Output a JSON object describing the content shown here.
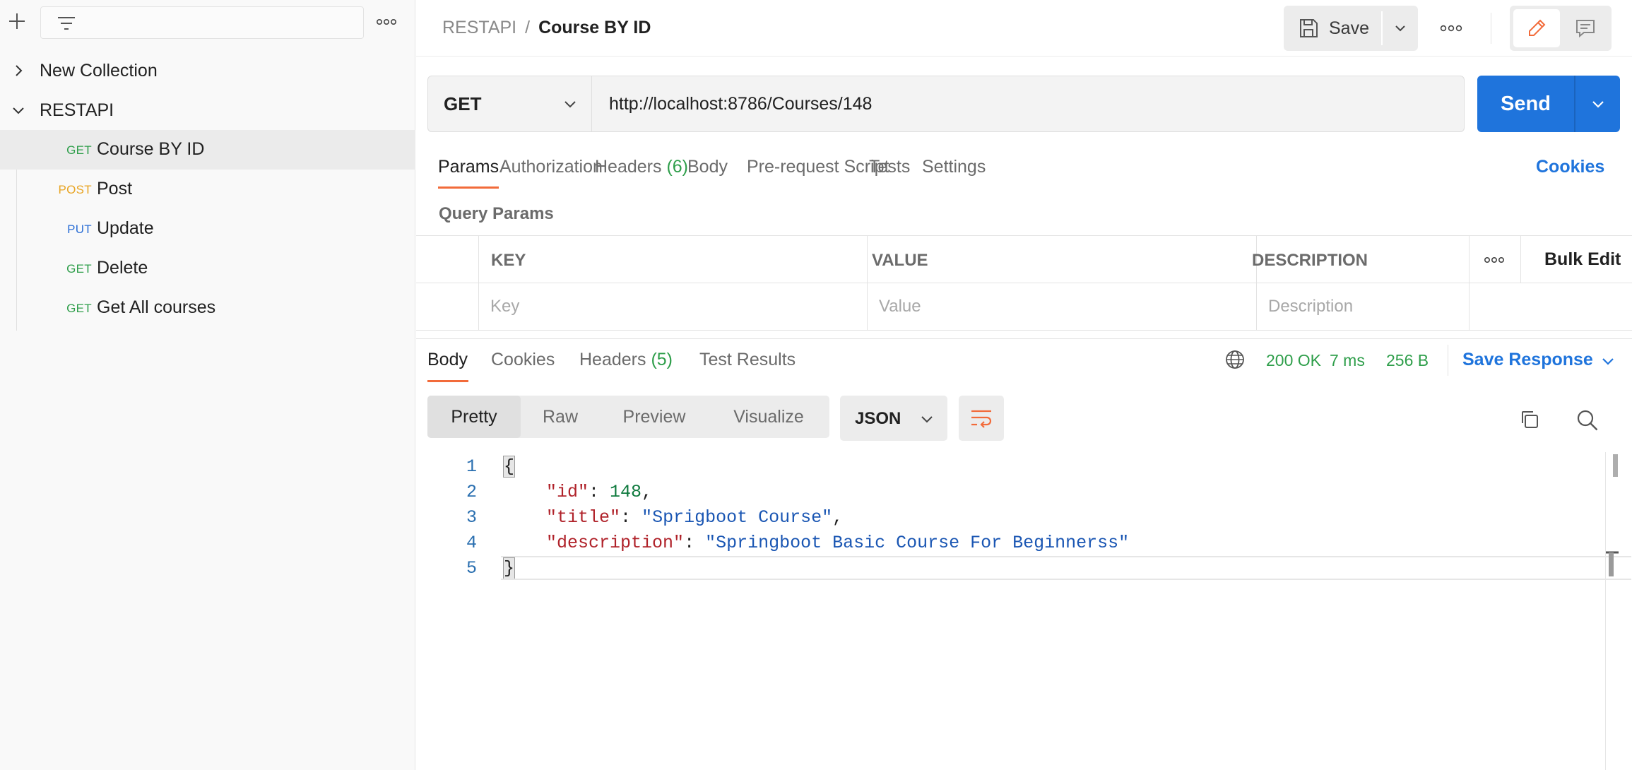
{
  "sidebar": {
    "search_placeholder": "",
    "collections": [
      {
        "name": "New Collection",
        "expanded": false
      },
      {
        "name": "RESTAPI",
        "expanded": true
      }
    ],
    "requests": [
      {
        "method": "GET",
        "name": "Course BY ID",
        "active": true
      },
      {
        "method": "POST",
        "name": "Post",
        "active": false
      },
      {
        "method": "PUT",
        "name": "Update",
        "active": false
      },
      {
        "method": "GET",
        "name": "Delete",
        "active": false
      },
      {
        "method": "GET",
        "name": "Get All courses",
        "active": false
      }
    ]
  },
  "header": {
    "breadcrumb_parent": "RESTAPI",
    "breadcrumb_sep": "/",
    "breadcrumb_current": "Course BY ID",
    "save_label": "Save"
  },
  "request": {
    "method": "GET",
    "url": "http://localhost:8786/Courses/148",
    "send_label": "Send",
    "tabs": [
      {
        "label": "Params",
        "count": ""
      },
      {
        "label": "Authorization",
        "count": ""
      },
      {
        "label": "Headers",
        "count": "(6)"
      },
      {
        "label": "Body",
        "count": ""
      },
      {
        "label": "Pre-request Script",
        "count": ""
      },
      {
        "label": "Tests",
        "count": ""
      },
      {
        "label": "Settings",
        "count": ""
      }
    ],
    "cookies_label": "Cookies",
    "query_params_title": "Query Params",
    "params_table": {
      "headers": [
        "KEY",
        "VALUE",
        "DESCRIPTION"
      ],
      "placeholders": [
        "Key",
        "Value",
        "Description"
      ],
      "bulk_edit_label": "Bulk Edit"
    }
  },
  "response": {
    "tabs": [
      {
        "label": "Body",
        "count": ""
      },
      {
        "label": "Cookies",
        "count": ""
      },
      {
        "label": "Headers",
        "count": "(5)"
      },
      {
        "label": "Test Results",
        "count": ""
      }
    ],
    "status": "200 OK",
    "time": "7 ms",
    "size": "256 B",
    "save_response_label": "Save Response",
    "views": [
      "Pretty",
      "Raw",
      "Preview",
      "Visualize"
    ],
    "format": "JSON",
    "lines": [
      {
        "num": "1",
        "text": "{"
      },
      {
        "num": "2",
        "text": "    \"id\": 148,"
      },
      {
        "num": "3",
        "text": "    \"title\": \"Sprigboot Course\","
      },
      {
        "num": "4",
        "text": "    \"description\": \"Springboot Basic Course For Beginnerss\""
      },
      {
        "num": "5",
        "text": "}"
      }
    ],
    "json": {
      "id": "148",
      "title": "\"Sprigboot Course\"",
      "description": "\"Springboot Basic Course For Beginnerss\""
    }
  },
  "colors": {
    "accent_blue": "#1f74dc",
    "tab_underline": "#f26b3a",
    "method_get": "#2e9e4a",
    "method_post": "#e8a524",
    "method_put": "#2c6fd6"
  },
  "icons": {
    "add": "plus-icon",
    "filter": "filter-icon",
    "more": "more-horizontal-icon",
    "save": "floppy-disk-icon",
    "edit": "pencil-icon",
    "comment": "comment-icon",
    "globe": "globe-icon",
    "wrap": "wrap-lines-icon",
    "copy": "copy-icon",
    "search": "search-icon"
  }
}
